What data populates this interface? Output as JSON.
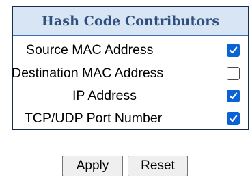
{
  "panel": {
    "title": "Hash Code Contributors",
    "rows": [
      {
        "label": "Source MAC Address",
        "checked": true
      },
      {
        "label": "Destination MAC Address",
        "checked": false
      },
      {
        "label": "IP Address",
        "checked": true
      },
      {
        "label": "TCP/UDP Port Number",
        "checked": true
      }
    ]
  },
  "buttons": {
    "apply_label": "Apply",
    "reset_label": "Reset"
  },
  "colors": {
    "header_bg": "#d8e5f5",
    "header_text": "#2f4f7c",
    "checkbox_checked": "#0b62d4"
  }
}
